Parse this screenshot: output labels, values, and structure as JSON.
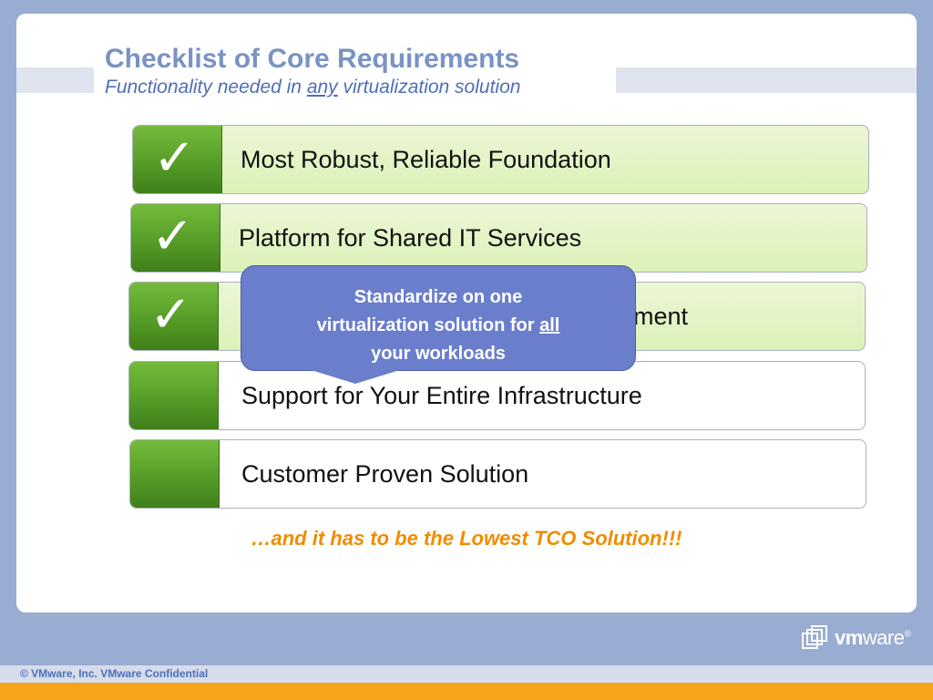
{
  "slide": {
    "title": "Checklist of Core Requirements",
    "subtitle_before": "Functionality needed in ",
    "subtitle_emphasis": "any",
    "subtitle_after": " virtualization solution"
  },
  "checklist": [
    {
      "label": "Most Robust, Reliable Foundation",
      "checked": true
    },
    {
      "label": "Platform for Shared IT Services",
      "checked": true
    },
    {
      "label": "ement",
      "checked": true
    },
    {
      "label": "Support for Your Entire Infrastructure",
      "checked": false
    },
    {
      "label": "Customer Proven Solution",
      "checked": false
    }
  ],
  "check_glyph": "✓",
  "callout": {
    "line1": "Standardize on one",
    "line2_before": "virtualization solution for ",
    "line2_emphasis": "all",
    "line3": "your workloads"
  },
  "tagline": "…and it has to be the Lowest TCO Solution!!!",
  "logo": {
    "bold": "vm",
    "rest": "ware",
    "mark": "®"
  },
  "footer": {
    "text": "© VMware, Inc. VMware Confidential"
  },
  "colors": {
    "title": "#7a93c4",
    "subtitle": "#4e6fb5",
    "check_box_green": "#59a02a",
    "checked_row_bg": "#e4f4c8",
    "callout_bg": "#6a7ecc",
    "tagline": "#f08c00",
    "footer_orange": "#f8a41b",
    "frame": "#99acd2"
  }
}
